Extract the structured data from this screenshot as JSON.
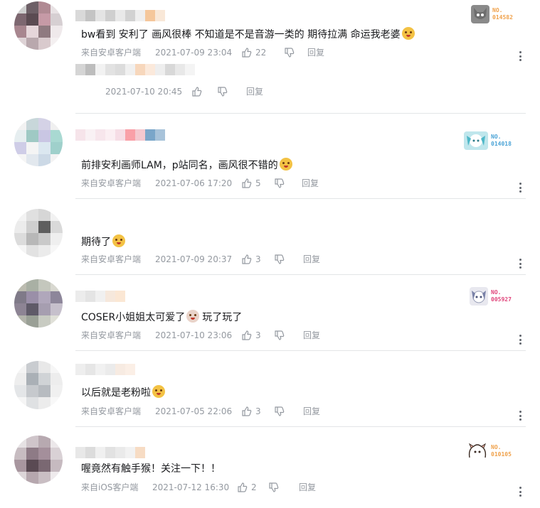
{
  "colors": {
    "text": "#18191c",
    "meta": "#9499a0",
    "divider": "#e3e5e7"
  },
  "comments": [
    {
      "text": "bw看到 安利了 画风很棒 不知道是不是音游一类的 期待拉满 命运我老婆",
      "source": "来自安卓客户端",
      "time": "2021-07-09 23:04",
      "likes": "22",
      "reply_label": "回复",
      "badge_no": "NO.",
      "badge_num": "014582",
      "badge_color": "#f0a14a",
      "sub_reply": {
        "time": "2021-07-10 20:45",
        "reply_label": "回复"
      }
    },
    {
      "text": "前排安利画师LAM，p站同名，画风很不错的",
      "source": "来自安卓客户端",
      "time": "2021-07-06 17:20",
      "likes": "5",
      "reply_label": "回复",
      "badge_no": "NO.",
      "badge_num": "014018",
      "badge_color": "#4aa3d6"
    },
    {
      "text": "期待了",
      "source": "来自安卓客户端",
      "time": "2021-07-09 20:37",
      "likes": "3",
      "reply_label": "回复"
    },
    {
      "text": "COSER小姐姐太可爱了",
      "text2": "玩了玩了",
      "source": "来自安卓客户端",
      "time": "2021-07-10 23:06",
      "likes": "3",
      "reply_label": "回复",
      "badge_no": "NO.",
      "badge_num": "005927",
      "badge_color": "#e0457b"
    },
    {
      "text": "以后就是老粉啦",
      "source": "来自安卓客户端",
      "time": "2021-07-05 22:06",
      "likes": "3",
      "reply_label": "回复"
    },
    {
      "text": "喔竟然有触手猴！关注一下！！",
      "source": "来自iOS客户端",
      "time": "2021-07-12 16:30",
      "likes": "2",
      "reply_label": "回复",
      "badge_no": "NO.",
      "badge_num": "010105",
      "badge_color": "#f0a14a"
    }
  ]
}
